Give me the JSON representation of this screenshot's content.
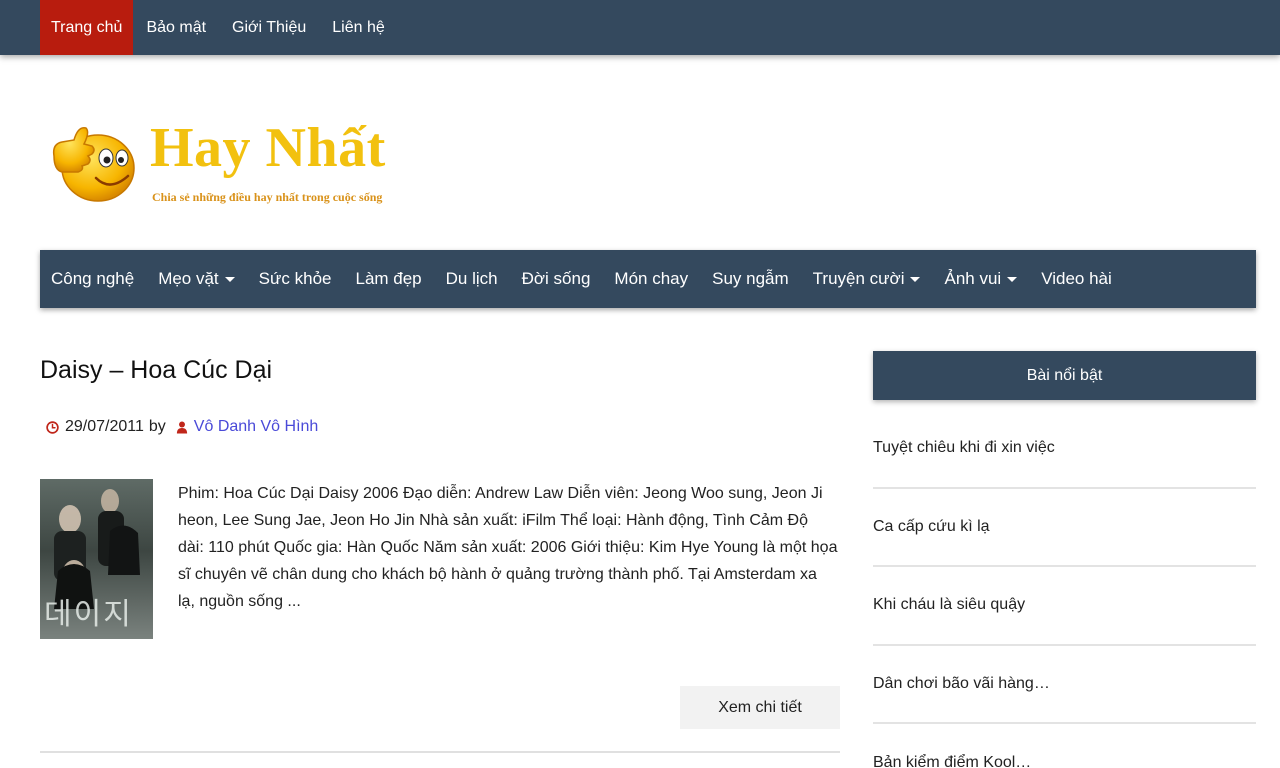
{
  "top_nav": {
    "items": [
      "Trang chủ",
      "Bảo mật",
      "Giới Thiệu",
      "Liên hệ"
    ],
    "active_index": 0
  },
  "logo": {
    "title": "Hay Nhất",
    "tagline": "Chia sẻ những điều hay nhất trong cuộc sống"
  },
  "category_nav": {
    "items": [
      {
        "label": "Công nghệ",
        "has_dropdown": false
      },
      {
        "label": "Mẹo vặt",
        "has_dropdown": true
      },
      {
        "label": "Sức khỏe",
        "has_dropdown": false
      },
      {
        "label": "Làm đẹp",
        "has_dropdown": false
      },
      {
        "label": "Du lịch",
        "has_dropdown": false
      },
      {
        "label": "Đời sống",
        "has_dropdown": false
      },
      {
        "label": "Món chay",
        "has_dropdown": false
      },
      {
        "label": "Suy ngẫm",
        "has_dropdown": false
      },
      {
        "label": "Truyện cười",
        "has_dropdown": true
      },
      {
        "label": "Ảnh vui",
        "has_dropdown": true
      },
      {
        "label": "Video hài",
        "has_dropdown": false
      }
    ]
  },
  "post": {
    "title": "Daisy – Hoa Cúc Dại",
    "date": "29/07/2011",
    "by": "by",
    "author": "Vô Danh Vô Hình",
    "thumbnail_text": "데이지",
    "excerpt": "Phim: Hoa Cúc Dại Daisy 2006 Đạo diễn: Andrew Law Diễn viên: Jeong Woo sung, Jeon Ji heon, Lee Sung Jae, Jeon Ho Jin Nhà sản xuất: iFilm Thể loại: Hành động, Tình Cảm Độ dài: 110 phút Quốc gia: Hàn Quốc Năm sản xuất: 2006 Giới thiệu: Kim Hye Young là một họa sĩ chuyên vẽ chân dung cho khách bộ hành ở quảng trường thành phố. Tại Amsterdam xa lạ, nguồn sống ...",
    "read_more": "Xem chi tiết"
  },
  "sidebar": {
    "title": "Bài nổi bật",
    "items": [
      "Tuyệt chiêu khi đi xin việc",
      "Ca cấp cứu kì lạ",
      "Khi cháu là siêu quậy",
      "Dân chơi bão vãi hàng…",
      "Bản kiểm điểm Kool…"
    ]
  },
  "colors": {
    "nav_bg": "#34495e",
    "active_bg": "#b81c0e",
    "logo_yellow": "#f2c10f",
    "author_link": "#4a4ad8",
    "icon_red": "#c0261a"
  }
}
